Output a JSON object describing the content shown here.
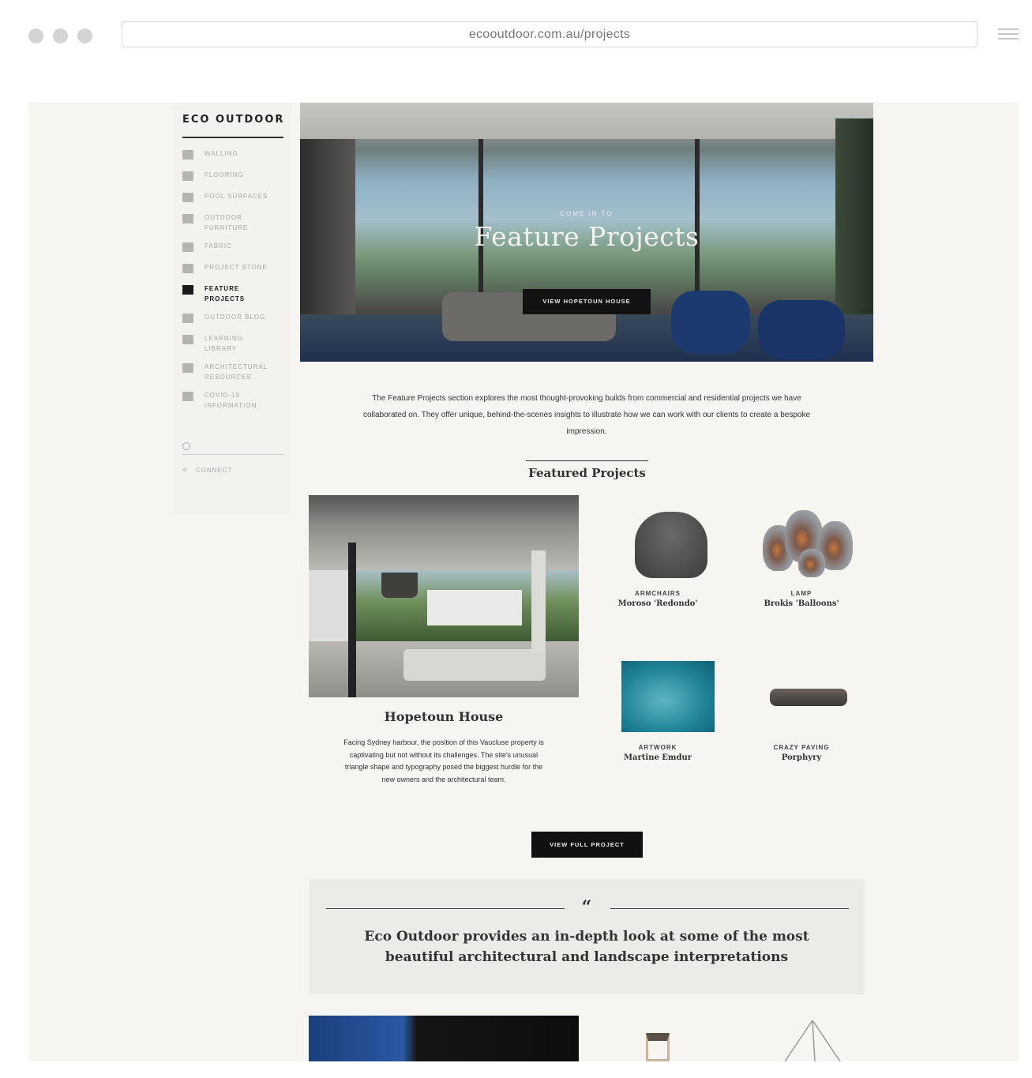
{
  "browser": {
    "url": "ecooutdoor.com.au/projects"
  },
  "sidebar": {
    "logo": "ECO OUTDOOR",
    "items": [
      {
        "label": "WALLING",
        "icon": "walling-icon"
      },
      {
        "label": "FLOORING",
        "icon": "flooring-icon"
      },
      {
        "label": "POOL SURFACES",
        "icon": "pool-icon"
      },
      {
        "label": "OUTDOOR FURNITURE",
        "icon": "furniture-icon"
      },
      {
        "label": "FABRIC",
        "icon": "fabric-icon"
      },
      {
        "label": "PROJECT STONE",
        "icon": "stone-icon"
      },
      {
        "label": "FEATURE PROJECTS",
        "icon": "folder-icon",
        "active": true
      },
      {
        "label": "OUTDOOR BLOG",
        "icon": "blog-icon"
      },
      {
        "label": "LEARNING LIBRARY",
        "icon": "book-icon"
      },
      {
        "label": "ARCHITECTURAL RESOURCES",
        "icon": "folder-icon"
      },
      {
        "label": "COVID-19 INFORMATION",
        "icon": "document-icon"
      }
    ],
    "search_icon": "search-icon",
    "connect_label": "CONNECT",
    "connect_icon": "share-icon"
  },
  "hero": {
    "subtitle": "COME IN TO",
    "title": "Feature Projects",
    "button_label": "VIEW HOPETOUN HOUSE"
  },
  "intro": {
    "text": "The Feature Projects section explores the most thought-provoking builds from commercial and residential projects we have collaborated on. They offer unique, behind-the-scenes insights to illustrate how we can work with our clients to create a bespoke impression."
  },
  "featured": {
    "heading": "Featured Projects",
    "project": {
      "title": "Hopetoun House",
      "description": "Facing Sydney harbour, the position of this Vaucluse property is captivating but not without its challenges. The site's unusual triangle shape and typography posed the biggest hurdle for the new owners and the architectural team.",
      "button_label": "VIEW FULL PROJECT"
    },
    "products": [
      {
        "category": "ARMCHAIRS",
        "name": "Moroso 'Redondo'"
      },
      {
        "category": "LAMP",
        "name": "Brokis 'Balloons'"
      },
      {
        "category": "ARTWORK",
        "name": "Martine Emdur"
      },
      {
        "category": "CRAZY PAVING",
        "name": "Porphyry"
      }
    ]
  },
  "quote": {
    "mark": "“",
    "text": "Eco Outdoor provides an in-depth look at some of the most beautiful architectural and landscape interpretations"
  },
  "colors": {
    "page_bg": "#f6f5f1",
    "button_bg": "#111111",
    "quote_bg": "#ecebe7"
  }
}
